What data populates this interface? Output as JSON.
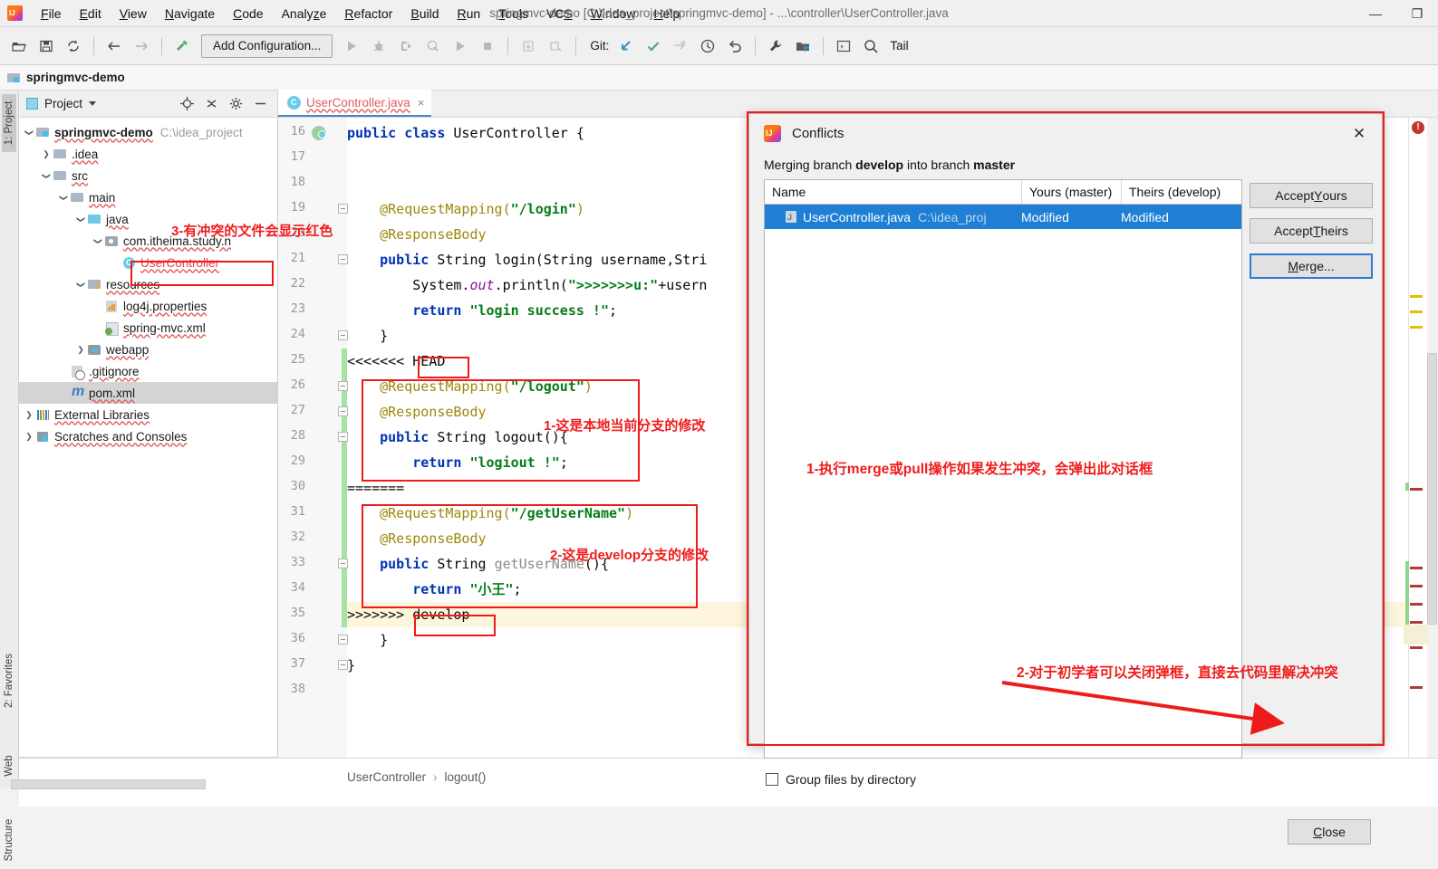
{
  "window": {
    "title": "springmvc-demo [C:\\idea_project\\springmvc-demo] - ...\\controller\\UserController.java",
    "minimize": "—",
    "maximize": "❐"
  },
  "menubar": [
    {
      "label": "File",
      "mn": "F"
    },
    {
      "label": "Edit",
      "mn": "E"
    },
    {
      "label": "View",
      "mn": "V"
    },
    {
      "label": "Navigate",
      "mn": "N"
    },
    {
      "label": "Code",
      "mn": "C"
    },
    {
      "label": "Analyze",
      "mn": "z"
    },
    {
      "label": "Refactor",
      "mn": "R"
    },
    {
      "label": "Build",
      "mn": "B"
    },
    {
      "label": "Run",
      "mn": "R"
    },
    {
      "label": "Tools",
      "mn": "T"
    },
    {
      "label": "VCS",
      "mn": "S"
    },
    {
      "label": "Window",
      "mn": "W"
    },
    {
      "label": "Help",
      "mn": "H"
    }
  ],
  "toolbar": {
    "open_icon": "open-folder-icon",
    "save_icon": "save-icon",
    "sync_icon": "sync-icon",
    "back_icon": "back-arrow-icon",
    "forward_icon": "forward-arrow-icon",
    "build_icon": "hammer-icon",
    "add_configuration": "Add Configuration...",
    "run_icon": "run-icon",
    "debug_icon": "debug-icon",
    "coverage_icon": "run-coverage-icon",
    "profile_icon": "run-profile-icon",
    "run2_icon": "run-alt-icon",
    "stop_icon": "stop-icon",
    "git_label": "Git:",
    "update_icon": "update-project-icon",
    "commit_icon": "commit-checkmark-icon",
    "push_icon": "push-icon",
    "history_icon": "history-clock-icon",
    "rollback_icon": "rollback-icon",
    "settings_icon": "wrench-icon",
    "project-structure_icon": "project-structure-icon",
    "terminal_icon": "terminal-icon",
    "search_icon": "search-icon",
    "tail_label": "Tail"
  },
  "project_bar": {
    "name": "springmvc-demo"
  },
  "left_rail": {
    "project": "1: Project",
    "favorites": "2: Favorites",
    "web": "Web",
    "structure": "Structure"
  },
  "project_panel": {
    "title": "Project",
    "locate_icon": "locate-icon",
    "collapse_icon": "collapse-all-icon",
    "settings_icon": "gear-icon",
    "hide_icon": "hide-icon",
    "tree": [
      {
        "label": "springmvc-demo",
        "path": "C:\\idea_project",
        "indent": 0,
        "arrow": "d",
        "icon": "ic-folder-src",
        "bold": true
      },
      {
        "label": ".idea",
        "path": "",
        "indent": 1,
        "arrow": "r",
        "icon": "ic-folder",
        "bold": false
      },
      {
        "label": "src",
        "path": "",
        "indent": 1,
        "arrow": "d",
        "icon": "ic-folder",
        "bold": false
      },
      {
        "label": "main",
        "path": "",
        "indent": 2,
        "arrow": "d",
        "icon": "ic-folder",
        "bold": false
      },
      {
        "label": "java",
        "path": "",
        "indent": 3,
        "arrow": "d",
        "icon": "ic-folder-blue",
        "bold": false
      },
      {
        "label": "com.itheima.study.n",
        "path": "",
        "indent": 4,
        "arrow": "d",
        "icon": "ic-pkg",
        "bold": false
      },
      {
        "label": "UserController",
        "path": "",
        "indent": 5,
        "arrow": "",
        "icon": "ic-class",
        "bold": false,
        "red": true
      },
      {
        "label": "resources",
        "path": "",
        "indent": 3,
        "arrow": "d",
        "icon": "ic-folder-res",
        "bold": false
      },
      {
        "label": "log4j.properties",
        "path": "",
        "indent": 4,
        "arrow": "",
        "icon": "ic-prop",
        "bold": false
      },
      {
        "label": "spring-mvc.xml",
        "path": "",
        "indent": 4,
        "arrow": "",
        "icon": "ic-xml",
        "bold": false
      },
      {
        "label": "webapp",
        "path": "",
        "indent": 3,
        "arrow": "r",
        "icon": "ic-web",
        "bold": false
      },
      {
        "label": ".gitignore",
        "path": "",
        "indent": 2,
        "arrow": "",
        "icon": "ic-git",
        "bold": false
      },
      {
        "label": "pom.xml",
        "path": "",
        "indent": 2,
        "arrow": "",
        "icon": "ic-maven",
        "bold": false,
        "selected": true
      },
      {
        "label": "External Libraries",
        "path": "",
        "indent": 0,
        "arrow": "r",
        "icon": "ic-lib",
        "bold": false
      },
      {
        "label": "Scratches and Consoles",
        "path": "",
        "indent": 0,
        "arrow": "r",
        "icon": "ic-scratch",
        "bold": false
      }
    ]
  },
  "editor": {
    "tab_label": "UserController.java",
    "tab_close": "×",
    "first_line": 16,
    "lines": [
      {
        "n": 16,
        "code": "public class UserController {",
        "tokens": [
          [
            "kw",
            "public "
          ],
          [
            "kw",
            "class "
          ],
          [
            "plain",
            "UserController {"
          ]
        ]
      },
      {
        "n": 17,
        "code": "",
        "tokens": []
      },
      {
        "n": 18,
        "code": "",
        "tokens": []
      },
      {
        "n": 19,
        "code": "    @RequestMapping(\"/login\")",
        "tokens": [
          [
            "ann",
            "    @RequestMapping("
          ],
          [
            "str",
            "\"/login\""
          ],
          [
            "ann",
            ")"
          ]
        ]
      },
      {
        "n": 20,
        "code": "    @ResponseBody",
        "tokens": [
          [
            "ann",
            "    @ResponseBody"
          ]
        ]
      },
      {
        "n": 21,
        "code": "    public String login(String username,Stri",
        "tokens": [
          [
            "kw",
            "    public "
          ],
          [
            "plain",
            "String login(String username,Stri"
          ]
        ]
      },
      {
        "n": 22,
        "code": "        System.out.println(\">>>>>>>u:\"+usern",
        "tokens": [
          [
            "plain",
            "        System."
          ],
          [
            "fld",
            "out"
          ],
          [
            "plain",
            ".println("
          ],
          [
            "str",
            "\">>>>>>>u:\""
          ],
          [
            "plain",
            "+usern"
          ]
        ]
      },
      {
        "n": 23,
        "code": "        return \"login success !\";",
        "tokens": [
          [
            "kw",
            "        return "
          ],
          [
            "str",
            "\"login success !\""
          ],
          [
            "plain",
            ";"
          ]
        ]
      },
      {
        "n": 24,
        "code": "    }",
        "tokens": [
          [
            "plain",
            "    }"
          ]
        ]
      },
      {
        "n": 25,
        "code": "<<<<<<< HEAD",
        "tokens": [
          [
            "plain",
            "<<<<<<< "
          ],
          [
            "plain",
            "HEAD"
          ]
        ]
      },
      {
        "n": 26,
        "code": "    @RequestMapping(\"/logout\")",
        "tokens": [
          [
            "ann",
            "    @RequestMapping("
          ],
          [
            "str",
            "\"/logout\""
          ],
          [
            "ann",
            ")"
          ]
        ]
      },
      {
        "n": 27,
        "code": "    @ResponseBody",
        "tokens": [
          [
            "ann",
            "    @ResponseBody"
          ]
        ]
      },
      {
        "n": 28,
        "code": "    public String logout(){",
        "tokens": [
          [
            "kw",
            "    public "
          ],
          [
            "plain",
            "String logout(){"
          ]
        ]
      },
      {
        "n": 29,
        "code": "        return \"logiout !\";",
        "tokens": [
          [
            "kw",
            "        return "
          ],
          [
            "str",
            "\"logiout !\""
          ],
          [
            "plain",
            ";"
          ]
        ]
      },
      {
        "n": 30,
        "code": "=======",
        "tokens": [
          [
            "plain",
            "======="
          ]
        ]
      },
      {
        "n": 31,
        "code": "    @RequestMapping(\"/getUserName\")",
        "tokens": [
          [
            "ann",
            "    @RequestMapping("
          ],
          [
            "str",
            "\"/getUserName\""
          ],
          [
            "ann",
            ")"
          ]
        ]
      },
      {
        "n": 32,
        "code": "    @ResponseBody",
        "tokens": [
          [
            "ann",
            "    @ResponseBody"
          ]
        ]
      },
      {
        "n": 33,
        "code": "    public String getUserName(){",
        "tokens": [
          [
            "kw",
            "    public "
          ],
          [
            "plain",
            "String "
          ],
          [
            "meth",
            "getUserName"
          ],
          [
            "plain",
            "(){"
          ]
        ]
      },
      {
        "n": 34,
        "code": "        return \"小王\";",
        "tokens": [
          [
            "kw",
            "        return "
          ],
          [
            "str",
            "\"小王\""
          ],
          [
            "plain",
            ";"
          ]
        ]
      },
      {
        "n": 35,
        "code": ">>>>>>> develop",
        "tokens": [
          [
            "plain",
            ">>>>>>> "
          ],
          [
            "plain",
            "develop"
          ]
        ]
      },
      {
        "n": 36,
        "code": "    }",
        "tokens": [
          [
            "plain",
            "    }"
          ]
        ]
      },
      {
        "n": 37,
        "code": "}",
        "tokens": [
          [
            "plain",
            "}"
          ]
        ]
      },
      {
        "n": 38,
        "code": "",
        "tokens": []
      }
    ],
    "head_marker": "HEAD",
    "develop_marker": "develop"
  },
  "breadcrumb": {
    "class": "UserController",
    "separator": "›",
    "method": "logout()"
  },
  "dialog": {
    "title": "Conflicts",
    "close_icon": "✕",
    "subtitle_prefix": "Merging branch ",
    "subtitle_branch_from": "develop",
    "subtitle_mid": " into branch ",
    "subtitle_branch_to": "master",
    "columns": {
      "name": "Name",
      "yours": "Yours (master)",
      "theirs": "Theirs (develop)"
    },
    "rows": [
      {
        "name": "UserController.java",
        "path": "C:\\idea_proj",
        "yours": "Modified",
        "theirs": "Modified"
      }
    ],
    "buttons": {
      "accept_yours": "Accept Yours",
      "accept_yours_mn": "Y",
      "accept_theirs": "Accept Theirs",
      "accept_theirs_mn": "T",
      "merge": "Merge...",
      "merge_mn": "M",
      "close": "Close",
      "close_mn": "C"
    },
    "group_checkbox": "Group files by directory",
    "group_checked": false
  },
  "annotations": [
    {
      "id": "anno-tree",
      "text": "3-有冲突的文件会显示红色"
    },
    {
      "id": "anno-local",
      "text": "1-这是本地当前分支的修改"
    },
    {
      "id": "anno-develop",
      "text": "2-这是develop分支的修改"
    },
    {
      "id": "anno-dialog-1",
      "text": "1-执行merge或pull操作如果发生冲突，会弹出此对话框"
    },
    {
      "id": "anno-dialog-2",
      "text": "2-对于初学者可以关闭弹框，直接去代码里解决冲突"
    }
  ],
  "colors": {
    "annotation_red": "#f01c1c",
    "selection_blue": "#1f7fd4",
    "accent_blue": "#4a86c8",
    "string_green": "#067d17",
    "keyword_blue": "#0033b3",
    "annotation_gold": "#9e880d"
  }
}
